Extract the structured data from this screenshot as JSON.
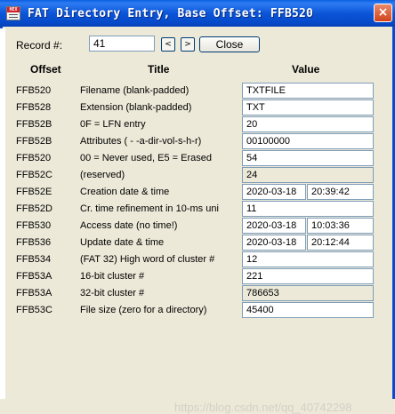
{
  "window": {
    "title": "FAT Directory Entry, Base Offset: FFB520",
    "icon": "hex-editor-icon",
    "icon_text": "HEX"
  },
  "record": {
    "label": "Record #:",
    "value": "41",
    "prev": "<",
    "next": ">",
    "close_label": "Close"
  },
  "headers": {
    "offset": "Offset",
    "title": "Title",
    "value": "Value"
  },
  "rows": [
    {
      "offset": "FFB520",
      "title": "Filename (blank-padded)",
      "value": "TXTFILE"
    },
    {
      "offset": "FFB528",
      "title": "Extension (blank-padded)",
      "value": "TXT"
    },
    {
      "offset": "FFB52B",
      "title": "0F = LFN entry",
      "value": "20"
    },
    {
      "offset": "FFB52B",
      "title": "Attributes ( - -a-dir-vol-s-h-r)",
      "value": "00100000"
    },
    {
      "offset": "FFB520",
      "title": "00 = Never used, E5 = Erased",
      "value": "54"
    },
    {
      "offset": "FFB52C",
      "title": "(reserved)",
      "value": "24",
      "readonly": true
    },
    {
      "offset": "FFB52E",
      "title": "Creation date & time",
      "value": "2020-03-18",
      "value2": "20:39:42"
    },
    {
      "offset": "FFB52D",
      "title": "Cr. time refinement in 10-ms uni",
      "value": "11"
    },
    {
      "offset": "FFB530",
      "title": "Access date (no time!)",
      "value": "2020-03-18",
      "value2": "10:03:36"
    },
    {
      "offset": "FFB536",
      "title": "Update date & time",
      "value": "2020-03-18",
      "value2": "20:12:44"
    },
    {
      "offset": "FFB534",
      "title": "(FAT 32) High word of cluster #",
      "value": "12"
    },
    {
      "offset": "FFB53A",
      "title": "16-bit cluster #",
      "value": "221"
    },
    {
      "offset": "FFB53A",
      "title": "32-bit cluster #",
      "value": "786653",
      "readonly": true
    },
    {
      "offset": "FFB53C",
      "title": "File size (zero for a directory)",
      "value": "45400"
    }
  ],
  "watermark": "https://blog.csdn.net/qq_40742298"
}
